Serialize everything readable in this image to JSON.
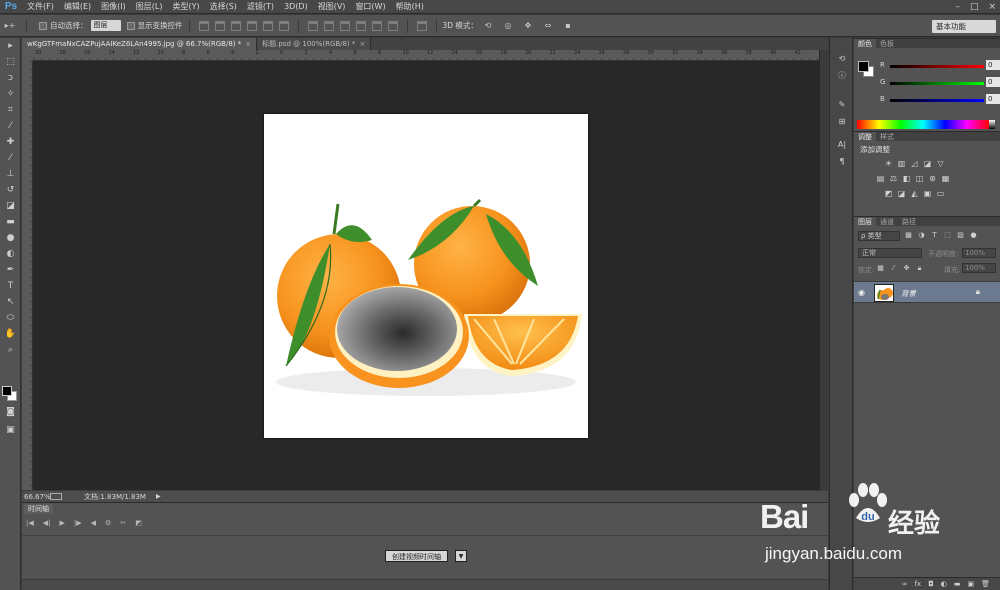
{
  "app": {
    "logo": "Ps"
  },
  "menu": [
    "文件(F)",
    "编辑(E)",
    "图像(I)",
    "图层(L)",
    "类型(Y)",
    "选择(S)",
    "滤镜(T)",
    "3D(D)",
    "视图(V)",
    "窗口(W)",
    "帮助(H)"
  ],
  "options": {
    "auto_select_label": "自动选择：",
    "auto_select_value": "图层",
    "show_transform_label": "显示变换控件",
    "mode_3d_label": "3D 模式：",
    "workspace": "基本功能"
  },
  "doc_tabs": [
    {
      "title": "wKgGTFmaNxCAZPujAAIKeZ6LAn4995.jpg @ 66.7%(RGB/8) *",
      "active": true
    },
    {
      "title": "标题.psd @ 100%(RGB/8) *",
      "active": false
    }
  ],
  "ruler_ticks": [
    "20",
    "18",
    "16",
    "14",
    "12",
    "10",
    "8",
    "6",
    "4",
    "2",
    "0",
    "2",
    "4",
    "6",
    "8",
    "10",
    "12",
    "14",
    "16",
    "18",
    "20",
    "22",
    "24",
    "26",
    "28",
    "30",
    "32",
    "34",
    "36",
    "38",
    "40",
    "42"
  ],
  "status": {
    "zoom": "66.67%",
    "doc_info": "文档:1.83M/1.83M"
  },
  "timeline": {
    "tab": "时间轴",
    "create_button": "创建视频时间轴"
  },
  "color_panel": {
    "tabs": [
      "颜色",
      "色板"
    ],
    "channels": [
      {
        "label": "R",
        "value": "0",
        "color": "#ff0000"
      },
      {
        "label": "G",
        "value": "0",
        "color": "#00ff00"
      },
      {
        "label": "B",
        "value": "0",
        "color": "#0000ff"
      }
    ]
  },
  "adjust_panel": {
    "tabs": [
      "调整",
      "样式"
    ],
    "title": "添加调整"
  },
  "layers_panel": {
    "tabs": [
      "图层",
      "通道",
      "路径"
    ],
    "filter_label": "ρ 类型",
    "blend_mode": "正常",
    "opacity_label": "不透明度:",
    "opacity_value": "100%",
    "lock_label": "锁定:",
    "fill_label": "填充:",
    "fill_value": "100%",
    "layer_name": "背景"
  },
  "watermark": {
    "brand": "Bai",
    "brand_cn": "经验",
    "url": "jingyan.baidu.com"
  },
  "colors": {
    "accent": "#5aa7e6",
    "selected_layer": "#6c7a8f",
    "canvas_bg": "#282828"
  }
}
